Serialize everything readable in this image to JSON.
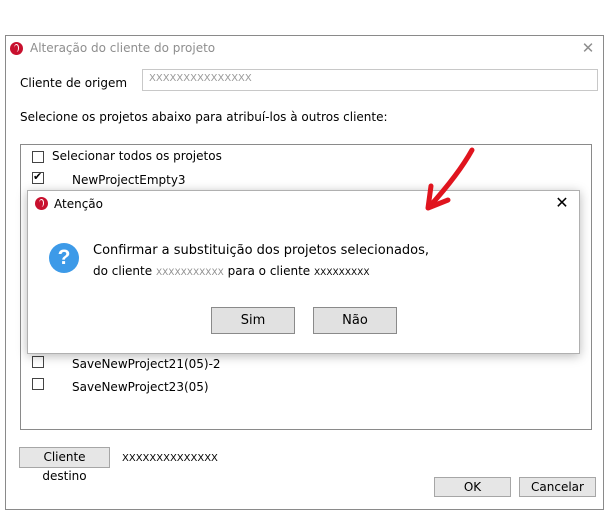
{
  "main_window": {
    "title": "Alteração do cliente do projeto",
    "close_glyph": "✕",
    "origin_label": "Cliente de origem",
    "origin_value": "XXXXXXXXXXXXXXX",
    "instruction": "Selecione os projetos abaixo para atribuí-los à outros cliente:",
    "select_all_label": "Selecionar todos os projetos",
    "projects": [
      {
        "name": "NewProjectEmpty3",
        "checked": true
      },
      {
        "name": "SaveNewProject21(05)-2",
        "checked": false
      },
      {
        "name": "SaveNewProject23(05)",
        "checked": false
      }
    ],
    "dest_button_label": "Cliente destino",
    "dest_value": "XXXXXXXXXXXXXX",
    "ok_label": "OK",
    "cancel_label": "Cancelar"
  },
  "alert": {
    "title": "Atenção",
    "close_glyph": "✕",
    "icon_glyph": "?",
    "line1": "Confirmar a substituição dos projetos selecionados,",
    "line2_prefix": "do cliente",
    "line2_client_from": "XXXXXXXXXXX",
    "line2_middle": "para o cliente",
    "line2_client_to": "XXXXXXXXX",
    "yes_label": "Sim",
    "no_label": "Não"
  },
  "colors": {
    "brand": "#c8102e",
    "question_icon": "#3d9ae8",
    "annotation_arrow": "#e0141e"
  },
  "icons": [
    "app-logo-icon",
    "close-icon",
    "question-icon",
    "checkbox-icon",
    "annotation-arrow"
  ]
}
